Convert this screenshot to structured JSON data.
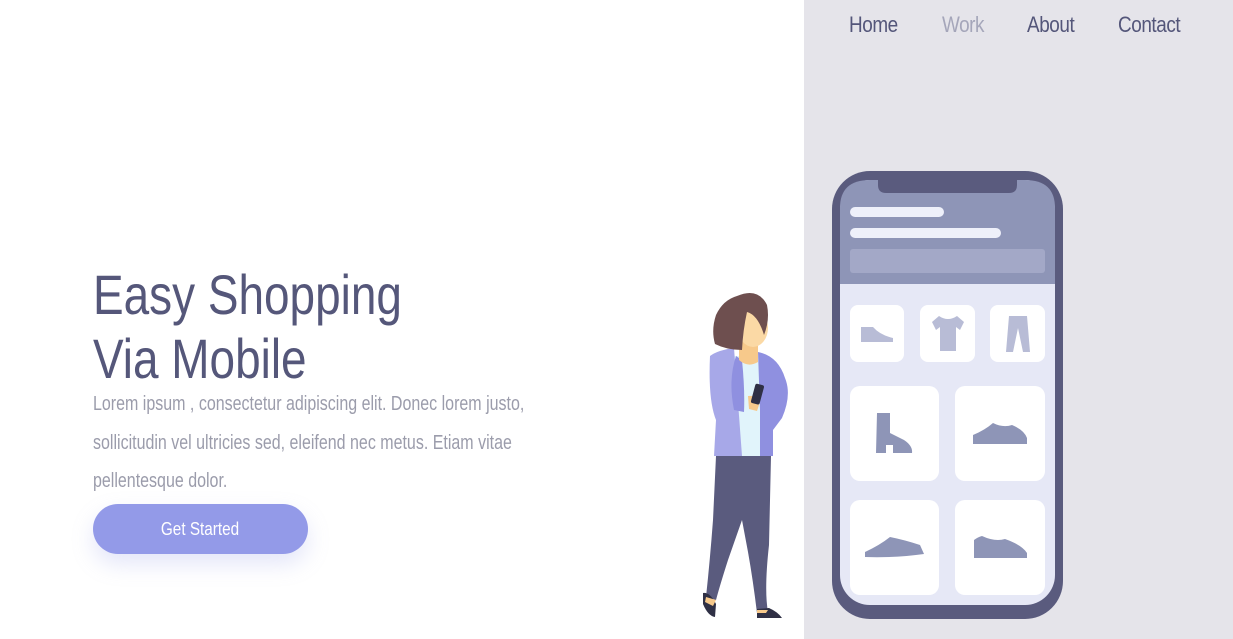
{
  "nav": {
    "items": [
      {
        "label": "Home",
        "active": false
      },
      {
        "label": "Work",
        "active": true
      },
      {
        "label": "About",
        "active": false
      },
      {
        "label": "Contact",
        "active": false
      }
    ]
  },
  "hero": {
    "title_line1": "Easy Shopping",
    "title_line2": "Via Mobile",
    "description": "Lorem ipsum , consectetur adipiscing elit. Donec lorem justo, sollicitudin vel ultricies sed, eleifend nec metus. Etiam vitae pellentesque dolor.",
    "cta_label": "Get Started"
  },
  "colors": {
    "primary_text": "#55577a",
    "muted_text": "#9b9cab",
    "accent": "#939ae8",
    "panel_bg": "#e5e4ea",
    "phone_frame": "#5a5b7e",
    "phone_header": "#8e95b7"
  },
  "phone": {
    "categories": [
      "shoe-icon",
      "tshirt-icon",
      "pants-icon"
    ],
    "products": [
      "boot-icon",
      "sneaker-icon",
      "flat-shoe-icon",
      "runner-shoe-icon"
    ]
  }
}
